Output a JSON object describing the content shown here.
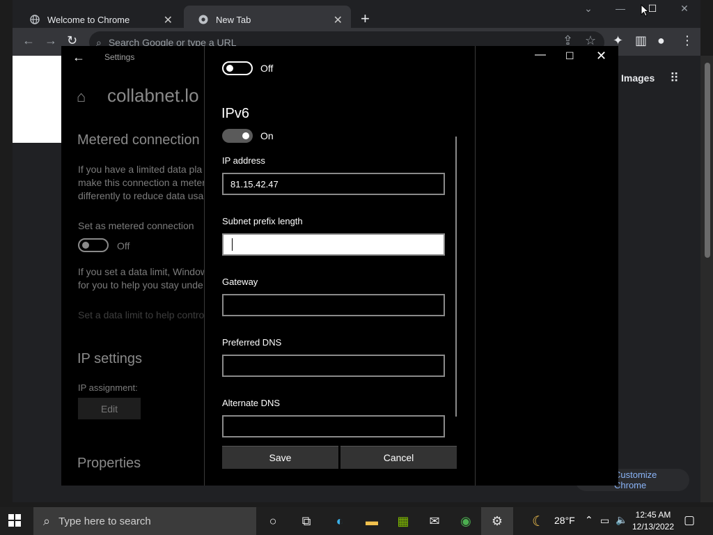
{
  "chrome": {
    "tabs": [
      {
        "label": "Welcome to Chrome"
      },
      {
        "label": "New Tab"
      }
    ],
    "omnibox_placeholder": "Search Google or type a URL",
    "images_link": "Images",
    "customize_label": "Customize Chrome"
  },
  "settings": {
    "title": "Settings",
    "network_name": "collabnet.lo",
    "metered_heading": "Metered connection",
    "metered_desc": [
      "If you have a limited data pla",
      "make this connection a meter",
      "differently to reduce data usa"
    ],
    "set_metered_label": "Set as metered connection",
    "metered_toggle_state": "Off",
    "data_limit_desc": [
      "If you set a data limit, Window",
      "for you to help you stay unde"
    ],
    "data_limit_link": "Set a data limit to help contro",
    "ip_settings_heading": "IP settings",
    "ip_assignment_label": "IP assignment:",
    "edit_label": "Edit",
    "properties_heading": "Properties"
  },
  "dialog": {
    "ipv4_toggle_state": "Off",
    "ipv6_heading": "IPv6",
    "ipv6_toggle_state": "On",
    "fields": {
      "ip_address": {
        "label": "IP address",
        "value": "81.15.42.47"
      },
      "subnet_prefix": {
        "label": "Subnet prefix length",
        "value": ""
      },
      "gateway": {
        "label": "Gateway",
        "value": ""
      },
      "preferred_dns": {
        "label": "Preferred DNS",
        "value": ""
      },
      "alternate_dns": {
        "label": "Alternate DNS",
        "value": ""
      }
    },
    "save_label": "Save",
    "cancel_label": "Cancel"
  },
  "taskbar": {
    "search_placeholder": "Type here to search",
    "temperature": "28°F",
    "time": "12:45 AM",
    "date": "12/13/2022"
  }
}
